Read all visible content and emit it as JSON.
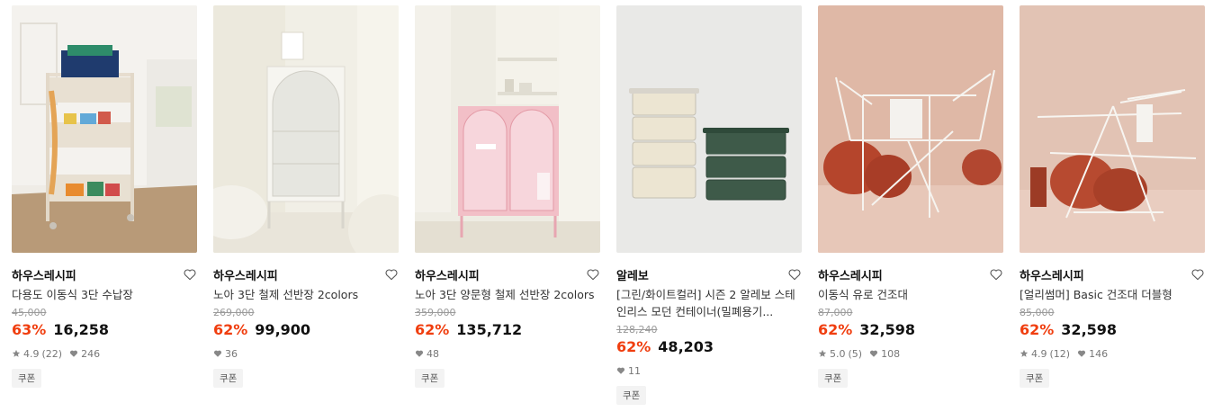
{
  "products": [
    {
      "brand": "하우스레시피",
      "title": "다용도 이동식 3단 수납장",
      "original_price": "45,000",
      "discount": "63%",
      "price": "16,258",
      "rating": "4.9",
      "reviews": "(22)",
      "likes": "246",
      "badge": "쿠폰"
    },
    {
      "brand": "하우스레시피",
      "title": "노아 3단 철제 선반장 2colors",
      "original_price": "269,000",
      "discount": "62%",
      "price": "99,900",
      "likes": "36",
      "badge": "쿠폰"
    },
    {
      "brand": "하우스레시피",
      "title": "노아 3단 양문형 철제 선반장 2colors",
      "original_price": "359,000",
      "discount": "62%",
      "price": "135,712",
      "likes": "48",
      "badge": "쿠폰"
    },
    {
      "brand": "알레보",
      "title": "[그린/화이트컬러] 시즌 2 알레보 스테인리스 모던 컨테이너(밀폐용기...",
      "original_price": "128,240",
      "discount": "62%",
      "price": "48,203",
      "likes": "11",
      "badge": "쿠폰"
    },
    {
      "brand": "하우스레시피",
      "title": "이동식 유로 건조대",
      "original_price": "87,000",
      "discount": "62%",
      "price": "32,598",
      "rating": "5.0",
      "reviews": "(5)",
      "likes": "108",
      "badge": "쿠폰"
    },
    {
      "brand": "하우스레시피",
      "title": "[얼리썸머] Basic 건조대 더블형",
      "original_price": "85,000",
      "discount": "62%",
      "price": "32,598",
      "rating": "4.9",
      "reviews": "(12)",
      "likes": "146",
      "badge": "쿠폰"
    }
  ],
  "icons": {
    "wishlist": "heart-outline-icon",
    "rating": "star-icon",
    "likes": "heart-icon"
  },
  "colors": {
    "discount": "#f03e0f",
    "price": "#111111",
    "badge_bg": "#f3f3f3"
  }
}
